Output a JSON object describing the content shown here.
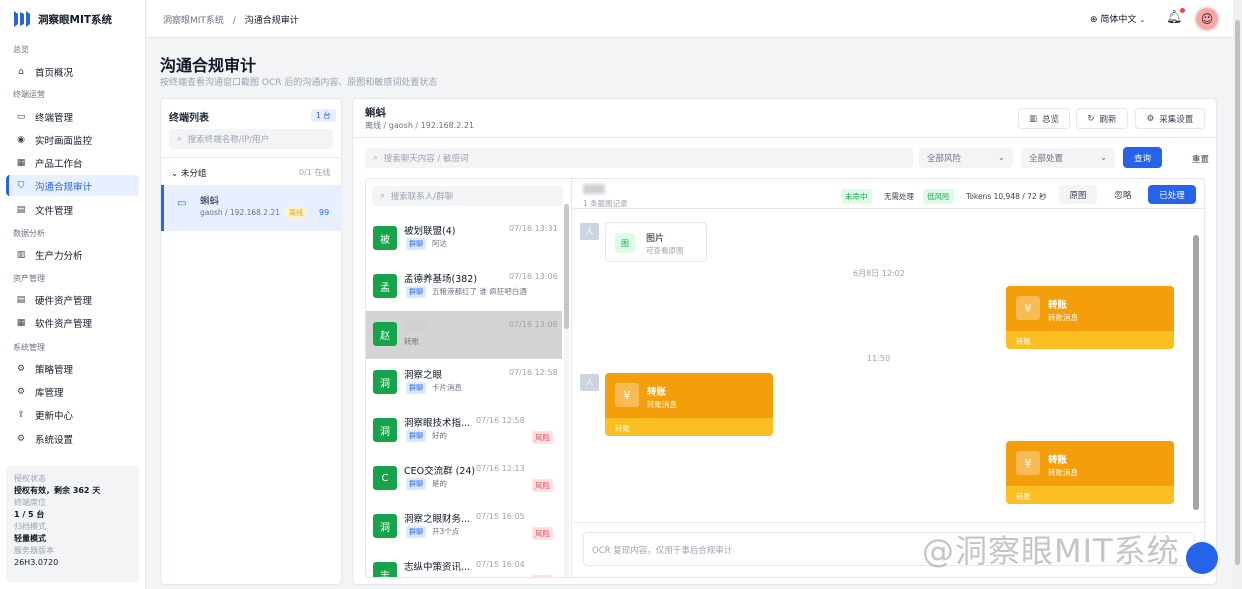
{
  "app": {
    "title": "洞察眼MIT系统"
  },
  "sidebar": {
    "sections": [
      "总览",
      "终端运营",
      "数据分析",
      "资产管理",
      "系统管理"
    ],
    "items": [
      {
        "label": "首页概况",
        "icon": "home-icon"
      },
      {
        "label": "终端管理",
        "icon": "monitor-icon"
      },
      {
        "label": "实时画面监控",
        "icon": "eye-icon"
      },
      {
        "label": "产品工作台",
        "icon": "grid-icon"
      },
      {
        "label": "沟通合规审计",
        "icon": "shield-icon"
      },
      {
        "label": "文件管理",
        "icon": "file-icon"
      },
      {
        "label": "生产力分析",
        "icon": "bar-chart-icon"
      },
      {
        "label": "硬件资产管理",
        "icon": "server-icon"
      },
      {
        "label": "软件资产管理",
        "icon": "grid-icon"
      },
      {
        "label": "策略管理",
        "icon": "gear-icon"
      },
      {
        "label": "库管理",
        "icon": "gear-icon"
      },
      {
        "label": "更新中心",
        "icon": "upload-icon"
      },
      {
        "label": "系统设置",
        "icon": "gear-icon"
      }
    ],
    "license": {
      "status_label": "授权状态",
      "status": "授权有效，剩余 362 天",
      "seats_label": "终端席位",
      "seats": "1 / 5 台",
      "mode_label": "归档模式",
      "mode": "轻量模式",
      "version_label": "服务器版本",
      "version": "26H3.0720"
    }
  },
  "topbar": {
    "breadcrumb_root": "洞察眼MIT系统",
    "breadcrumb_sep": "/",
    "breadcrumb_current": "沟通合规审计",
    "language": "简体中文"
  },
  "page": {
    "title": "沟通合规审计",
    "subtitle": "按终端查看沟通窗口截图 OCR 后的沟通内容、原图和敏感词处置状态"
  },
  "terminals": {
    "title": "终端列表",
    "count_badge": "1 台",
    "search_placeholder": "搜索终端名称/IP/用户",
    "group": "未分组",
    "group_count": "0/1 在线",
    "items": [
      {
        "name": "蝌蚪",
        "detail": "gaosh / 192.168.2.21",
        "status": "离线",
        "score": "99"
      }
    ]
  },
  "detail": {
    "name": "蝌蚪",
    "meta": "离线 / gaosh / 192.168.2.21",
    "buttons": {
      "overview": "总览",
      "refresh": "刷新",
      "settings": "采集设置"
    },
    "search_placeholder": "搜索聊天内容 / 敏感词",
    "risk_filter": "全部风险",
    "handle_filter": "全部处置",
    "query": "查询",
    "reset": "重置"
  },
  "conversations": {
    "search_placeholder": "搜索联系人/群聊",
    "items": [
      {
        "avatar": "被",
        "name": "被划联盟(4)",
        "time": "07/16 13:31",
        "tag": "群聊",
        "preview": "阿达",
        "risk": ""
      },
      {
        "avatar": "孟",
        "name": "孟德养基场(382)",
        "time": "07/16 13:06",
        "tag": "群聊",
        "preview": "五粮液都红了 谁 疯狂吧白酒",
        "risk": ""
      },
      {
        "avatar": "赵",
        "name": "",
        "time": "07/16 13:06",
        "tag": "",
        "preview": "转账",
        "risk": ""
      },
      {
        "avatar": "洞",
        "name": "洞察之眼",
        "time": "07/16 12:58",
        "tag": "群聊",
        "preview": "卡片消息",
        "risk": ""
      },
      {
        "avatar": "洞",
        "name": "洞察眼技术指...",
        "time": "07/16 12:58",
        "tag": "群聊",
        "preview": "好的",
        "risk": "风险"
      },
      {
        "avatar": "C",
        "name": "CEO交流群 (24)",
        "time": "07/16 12:13",
        "tag": "群聊",
        "preview": "是的",
        "risk": "风险"
      },
      {
        "avatar": "洞",
        "name": "洞察之眼财务...",
        "time": "07/15 16:05",
        "tag": "群聊",
        "preview": "开3个点",
        "risk": "风险"
      },
      {
        "avatar": "志",
        "name": "志纵中策资讯...",
        "time": "07/15 16:04",
        "tag": "",
        "preview": "",
        "risk": "风险"
      }
    ]
  },
  "chat": {
    "record_count": "1 条截图记录",
    "status_miss": "未命中",
    "status_none": "无需处理",
    "risk_low": "低风险",
    "tokens": "Tokens 10,948 / 72 秒",
    "btn_original": "原图",
    "btn_ignore": "忽略",
    "btn_done": "已处理",
    "image_card": {
      "title": "图片",
      "subtitle": "可查看原图",
      "icon": "图"
    },
    "timestamp1": "6月8日 12:02",
    "timestamp2": "11:50",
    "transfer": {
      "title": "转账",
      "subtitle": "转账消息",
      "footer": "转账",
      "symbol": "¥"
    },
    "avatar_char": "人",
    "input_placeholder": "OCR 复现内容，仅用于事后合规审计"
  },
  "watermark": "@洞察眼MIT系统",
  "colors": {
    "accent": "#2563eb",
    "transfer": "#f59e0b",
    "risk": "#ef4444",
    "group_avatar": "#16a34a"
  }
}
